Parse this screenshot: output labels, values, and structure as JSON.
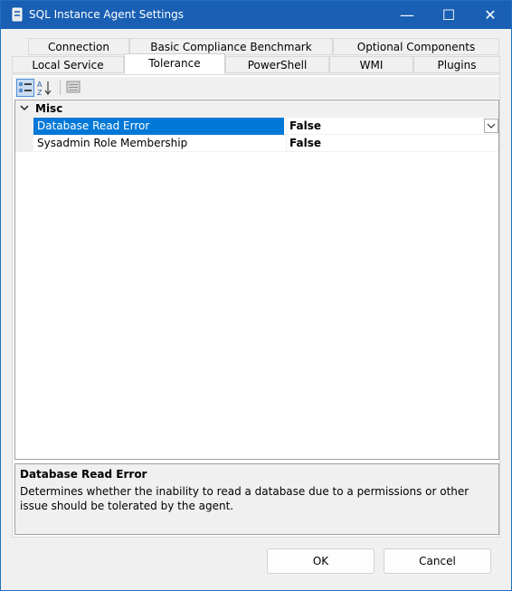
{
  "window": {
    "title": "SQL Instance Agent Settings",
    "minimize_glyph": "—",
    "maximize_glyph": "☐",
    "close_glyph": "✕"
  },
  "tabs": {
    "row_top": [
      "Connection",
      "Basic Compliance Benchmark",
      "Optional Components"
    ],
    "row_bottom": [
      "Local Service",
      "Tolerance",
      "PowerShell",
      "WMI",
      "Plugins"
    ],
    "selected": "Tolerance"
  },
  "toolbar": {
    "icons": [
      "categorized-icon",
      "alphabetical-icon",
      "property-pages-icon"
    ],
    "alphabetical_label": "A Z"
  },
  "grid": {
    "category": "Misc",
    "properties": [
      {
        "name": "Database Read Error",
        "value": "False",
        "selected": true
      },
      {
        "name": "Sysadmin Role Membership",
        "value": "False",
        "selected": false
      }
    ]
  },
  "help": {
    "title": "Database Read Error",
    "description": "Determines whether the inability to read a database due to a permissions or other issue should be tolerated by the agent."
  },
  "buttons": {
    "ok": "OK",
    "cancel": "Cancel"
  },
  "colors": {
    "titlebar": "#195fb3",
    "selection": "#0078d7"
  }
}
